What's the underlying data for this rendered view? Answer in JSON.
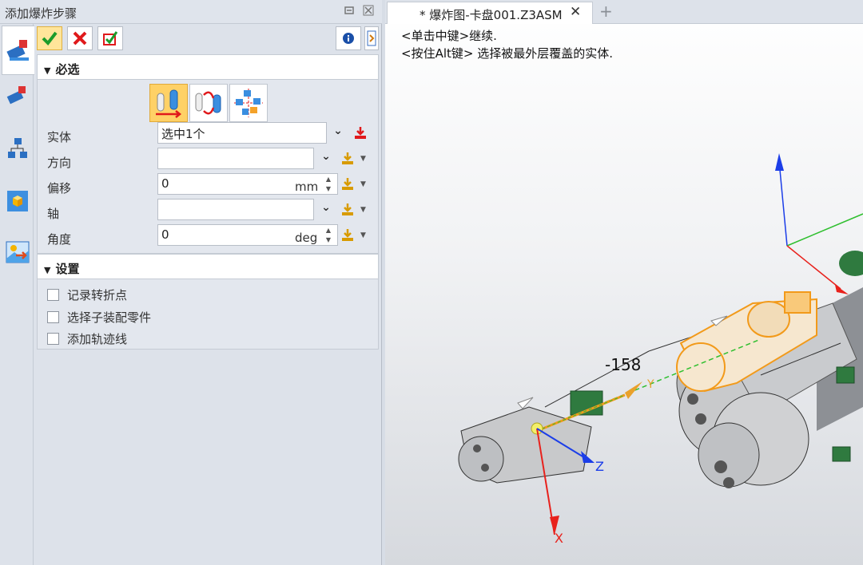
{
  "panel": {
    "title": "添加爆炸步骤",
    "titlebar_icons": [
      "restore-icon",
      "close-icon"
    ],
    "side_tabs": [
      "explode-step-icon",
      "explode-edit-icon",
      "hierarchy-icon",
      "view-cube-icon",
      "image-export-icon"
    ],
    "actions": {
      "ok": "confirm-icon",
      "cancel": "cancel-icon",
      "apply": "apply-icon",
      "info": "info-icon",
      "expand": "expand-icon"
    },
    "required_section": {
      "header": "必选",
      "modes": [
        "translate-mode-icon",
        "rotate-mode-icon",
        "radial-mode-icon"
      ],
      "fields": {
        "entity": {
          "label": "实体",
          "value": "选中1个"
        },
        "direction": {
          "label": "方向",
          "value": ""
        },
        "offset": {
          "label": "偏移",
          "value": "0",
          "unit": "mm"
        },
        "axis": {
          "label": "轴",
          "value": ""
        },
        "angle": {
          "label": "角度",
          "value": "0",
          "unit": "deg"
        }
      }
    },
    "settings_section": {
      "header": "设置",
      "checkboxes": [
        {
          "label": "记录转折点",
          "checked": false
        },
        {
          "label": "选择子装配零件",
          "checked": false
        },
        {
          "label": "添加轨迹线",
          "checked": false
        }
      ]
    }
  },
  "viewer": {
    "tab_label": "* 爆炸图-卡盘001.Z3ASM",
    "hints": [
      "<单击中键>继续.",
      "<按住Alt键> 选择被最外层覆盖的实体."
    ],
    "dimension": "-158",
    "axis_labels": {
      "x": "X",
      "y": "Y",
      "z": "Z"
    }
  },
  "colors": {
    "highlight": "#f29a1a",
    "axis_red": "#e8211c",
    "axis_blue": "#1c3ee8",
    "axis_green": "#2fbf2f",
    "part_gray": "#c8c9cb",
    "part_green": "#2f7a3f"
  }
}
